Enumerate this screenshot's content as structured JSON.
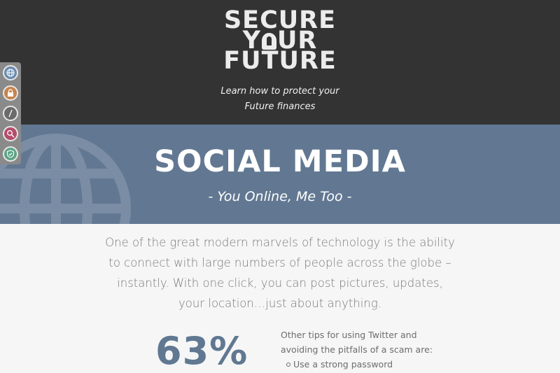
{
  "header": {
    "logo_lines": [
      "SECURE",
      "Y",
      "UR",
      "FUTURE"
    ],
    "tagline_line1": "Learn how to protect your",
    "tagline_line2": "Future finances"
  },
  "sidebar": {
    "items": [
      {
        "name": "globe-icon",
        "color": "#6a8bb0"
      },
      {
        "name": "lock-icon",
        "color": "#c8834b"
      },
      {
        "name": "pen-icon",
        "color": "#6b6b6b"
      },
      {
        "name": "search-icon",
        "color": "#b54d6c"
      },
      {
        "name": "shield-icon",
        "color": "#5ea488"
      }
    ]
  },
  "hero": {
    "title": "SOCIAL MEDIA",
    "subtitle": "- You Online, Me Too -",
    "background_color": "#627892"
  },
  "main": {
    "intro": "One of the great modern marvels of technology is the ability to connect with large numbers of people across the globe – instantly. With one click, you can post pictures, updates, your location…just about anything.",
    "stat": "63%",
    "tips_heading": "Other tips for using Twitter and avoiding the pitfalls of a scam are:",
    "tips": [
      "Use a strong password"
    ]
  }
}
